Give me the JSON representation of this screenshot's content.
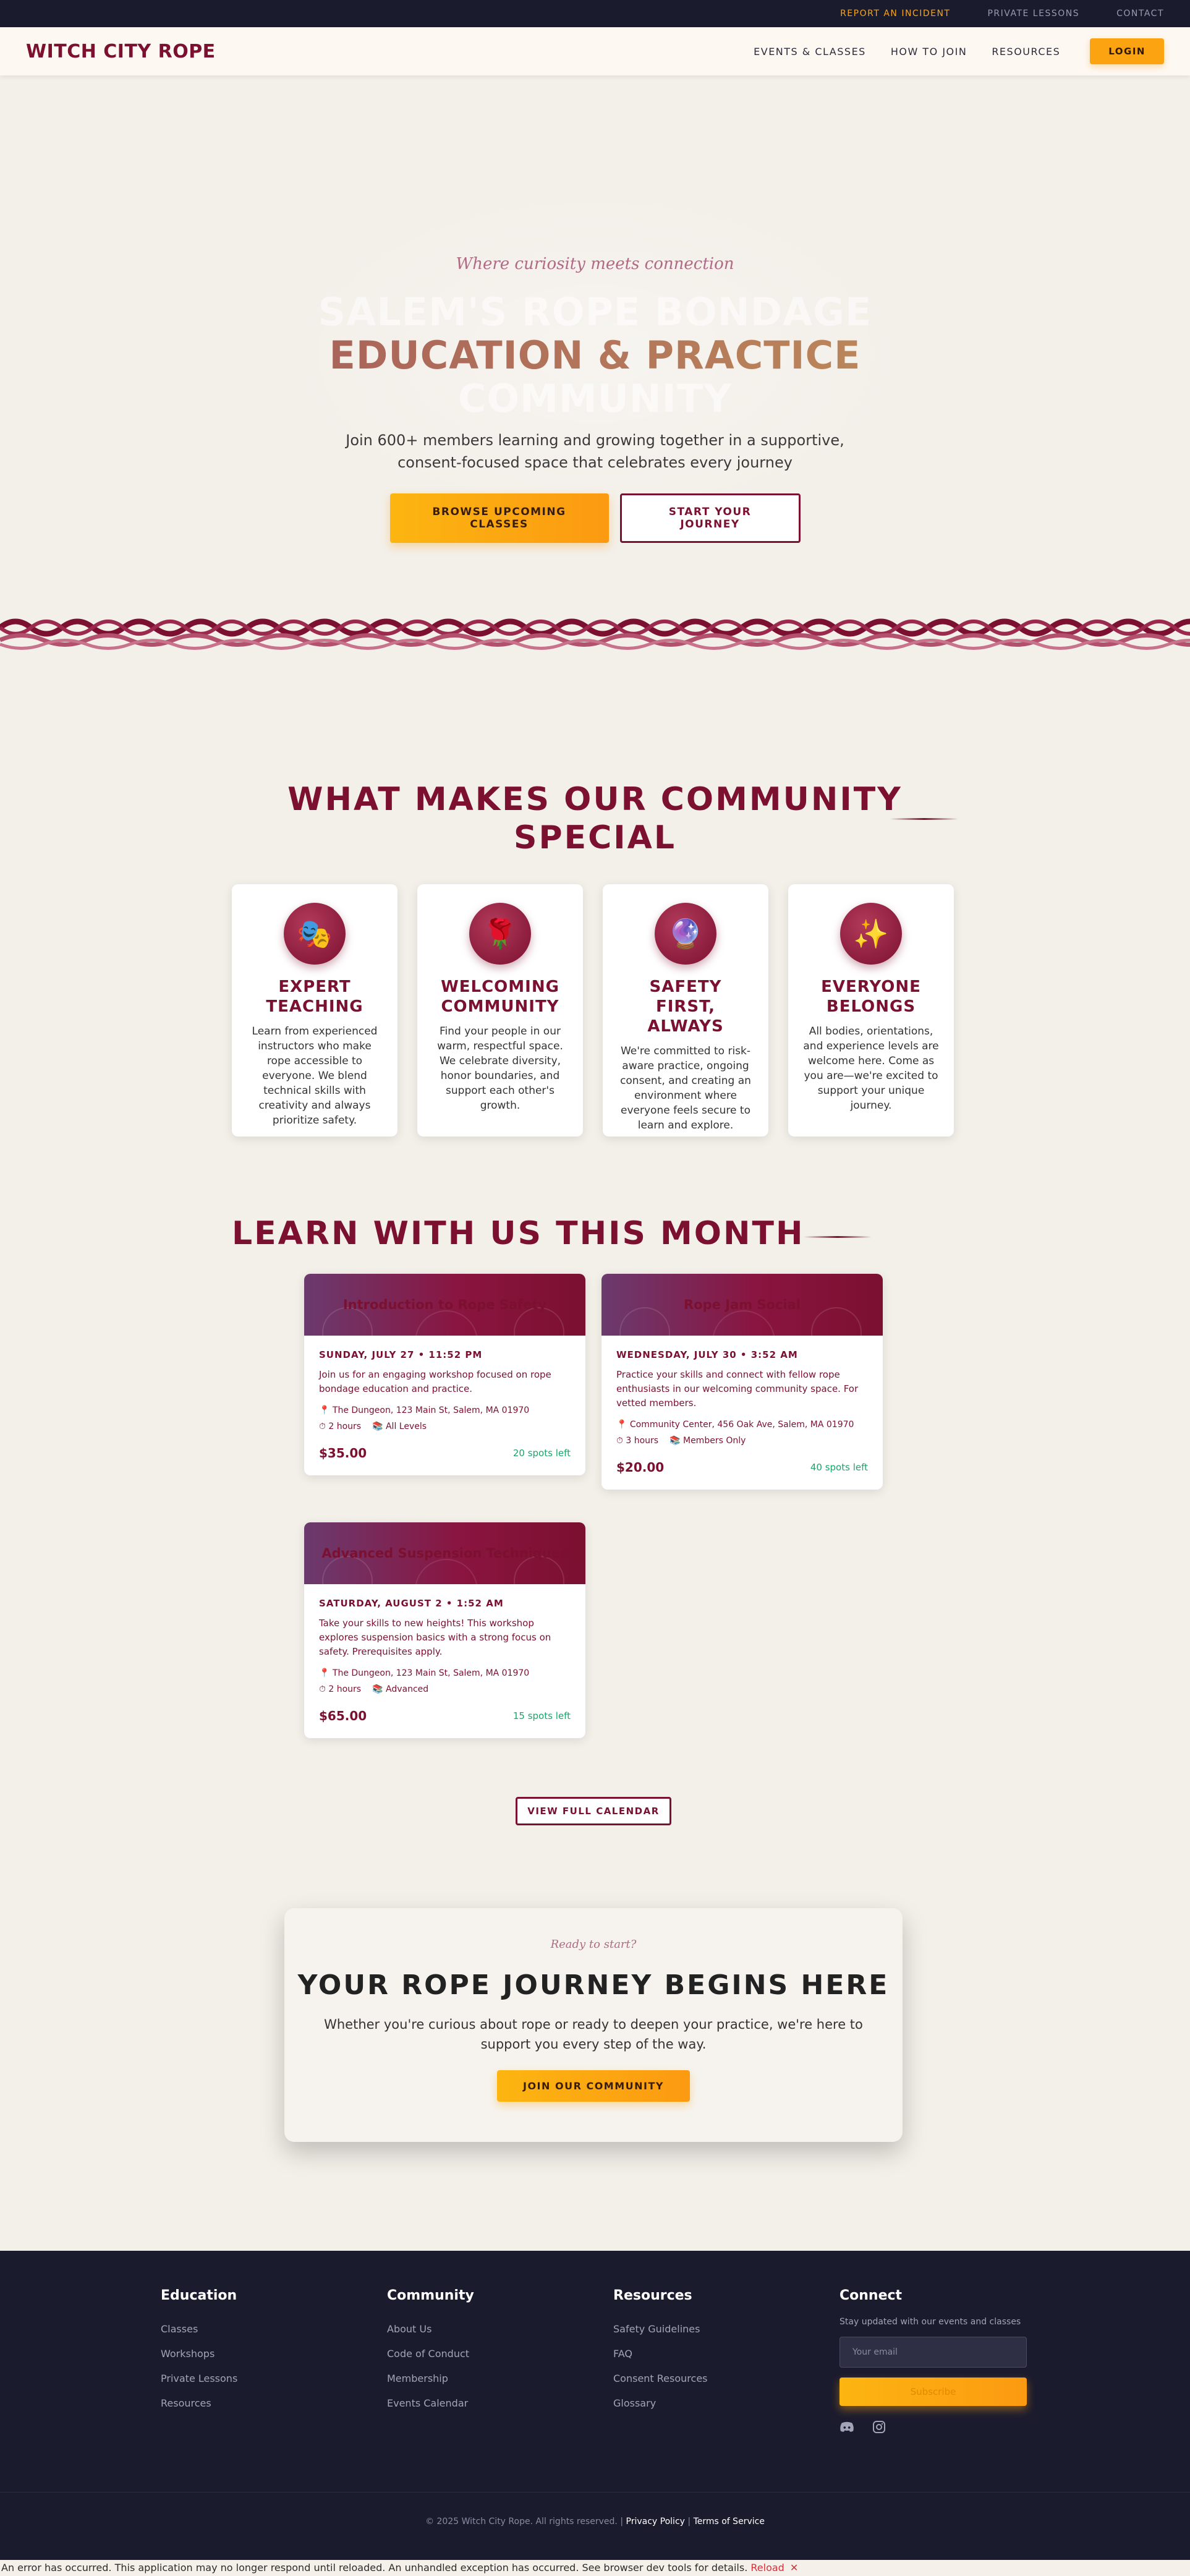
{
  "utility": {
    "incident": "REPORT AN INCIDENT",
    "private_lessons": "PRIVATE LESSONS",
    "contact": "CONTACT"
  },
  "header": {
    "logo": "WITCH CITY ROPE",
    "nav": [
      "EVENTS & CLASSES",
      "HOW TO JOIN",
      "RESOURCES"
    ],
    "login": "LOGIN"
  },
  "hero": {
    "tagline": "Where curiosity meets connection",
    "line1": "SALEM'S ROPE BONDAGE",
    "line2": "EDUCATION & PRACTICE",
    "line3": "COMMUNITY",
    "subtitle": "Join 600+ members learning and growing together in a supportive, consent-focused space that celebrates every journey",
    "primary_button": "BROWSE UPCOMING CLASSES",
    "secondary_button": "START YOUR JOURNEY"
  },
  "features": {
    "title": "WHAT MAKES OUR COMMUNITY SPECIAL",
    "cards": [
      {
        "icon": "🎭",
        "icon_name": "theater-masks-icon",
        "title": "EXPERT TEACHING",
        "text": "Learn from experienced instructors who make rope accessible to everyone. We blend technical skills with creativity and always prioritize safety."
      },
      {
        "icon": "🌹",
        "icon_name": "rose-icon",
        "title": "WELCOMING COMMUNITY",
        "text": "Find your people in our warm, respectful space. We celebrate diversity, honor boundaries, and support each other's growth."
      },
      {
        "icon": "🔮",
        "icon_name": "crystal-ball-icon",
        "title": "SAFETY FIRST, ALWAYS",
        "text": "We're committed to risk-aware practice, ongoing consent, and creating an environment where everyone feels secure to learn and explore."
      },
      {
        "icon": "✨",
        "icon_name": "sparkles-icon",
        "title": "EVERYONE BELONGS",
        "text": "All bodies, orientations, and experience levels are welcome here. Come as you are—we're excited to support your unique journey."
      }
    ]
  },
  "classes": {
    "title": "LEARN WITH US THIS MONTH",
    "items": [
      {
        "name": "Introduction to Rope Safety",
        "date": "SUNDAY, JULY 27 • 11:52 PM",
        "description": "Join us for an engaging workshop focused on rope bondage education and practice.",
        "location": "The Dungeon, 123 Main St, Salem, MA 01970",
        "duration": "2 hours",
        "level": "All Levels",
        "price": "$35.00",
        "spots": "20 spots left"
      },
      {
        "name": "Rope Jam Social",
        "date": "WEDNESDAY, JULY 30 • 3:52 AM",
        "description": "Practice your skills and connect with fellow rope enthusiasts in our welcoming community space. For vetted members.",
        "location": "Community Center, 456 Oak Ave, Salem, MA 01970",
        "duration": "3 hours",
        "level": "Members Only",
        "price": "$20.00",
        "spots": "40 spots left"
      },
      {
        "name": "Advanced Suspension Techniques",
        "date": "SATURDAY, AUGUST 2 • 1:52 AM",
        "description": "Take your skills to new heights! This workshop explores suspension basics with a strong focus on safety. Prerequisites apply.",
        "location": "The Dungeon, 123 Main St, Salem, MA 01970",
        "duration": "2 hours",
        "level": "Advanced",
        "price": "$65.00",
        "spots": "15 spots left"
      }
    ],
    "view_calendar": "VIEW FULL CALENDAR"
  },
  "cta": {
    "ready": "Ready to start?",
    "title": "YOUR ROPE JOURNEY BEGINS HERE",
    "text": "Whether you're curious about rope or ready to deepen your practice, we're here to support you every step of the way.",
    "button": "JOIN OUR COMMUNITY"
  },
  "footer": {
    "education": {
      "heading": "Education",
      "links": [
        "Classes",
        "Workshops",
        "Private Lessons",
        "Resources"
      ]
    },
    "community": {
      "heading": "Community",
      "links": [
        "About Us",
        "Code of Conduct",
        "Membership",
        "Events Calendar"
      ]
    },
    "resources": {
      "heading": "Resources",
      "links": [
        "Safety Guidelines",
        "FAQ",
        "Consent Resources",
        "Glossary"
      ]
    },
    "connect": {
      "heading": "Connect",
      "text": "Stay updated with our events and classes",
      "email_placeholder": "Your email",
      "subscribe": "Subscribe"
    },
    "copyright": "© 2025 Witch City Rope. All rights reserved.",
    "privacy": "Privacy Policy",
    "terms": "Terms of Service",
    "separator": "|"
  },
  "error": {
    "message": "An error has occurred. This application may no longer respond until reloaded. An unhandled exception has occurred. See browser dev tools for details.",
    "reload": "Reload",
    "dismiss": "✕"
  },
  "colors": {
    "brand_burgundy": "#7b1030",
    "accent_amber": "#fca311",
    "footer_bg": "#1b1b2e",
    "page_bg": "#f3efe9"
  }
}
